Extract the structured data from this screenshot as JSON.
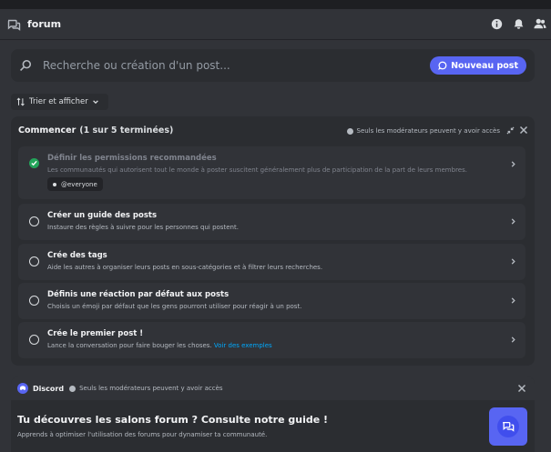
{
  "header": {
    "channel_name": "forum"
  },
  "search": {
    "placeholder": "Recherche ou création d'un post...",
    "new_post_label": "Nouveau post"
  },
  "sort": {
    "label": "Trier et afficher"
  },
  "onboarding": {
    "title": "Commencer",
    "progress": "(1 sur 5 terminées)",
    "mod_note": "Seuls les modérateurs peuvent y avoir accès",
    "tasks": [
      {
        "title": "Définir les permissions recommandées",
        "description": "Les communautés qui autorisent tout le monde à poster suscitent généralement plus de participation de la part de leurs membres.",
        "role": "@everyone",
        "completed": true
      },
      {
        "title": "Créer un guide des posts",
        "description": "Instaure des règles à suivre pour les personnes qui postent.",
        "completed": false
      },
      {
        "title": "Crée des tags",
        "description": "Aide les autres à organiser leurs posts en sous-catégories et à filtrer leurs recherches.",
        "completed": false
      },
      {
        "title": "Définis une réaction par défaut aux posts",
        "description": "Choisis un émoji par défaut que les gens pourront utiliser pour réagir à un post.",
        "completed": false
      },
      {
        "title": "Crée le premier post !",
        "description": "Lance la conversation pour faire bouger les choses.",
        "link": "Voir des exemples",
        "completed": false
      }
    ]
  },
  "guide": {
    "brand": "Discord",
    "mod_note": "Seuls les modérateurs peuvent y avoir accès",
    "title": "Tu découvres les salons forum ? Consulte notre guide !",
    "subtitle": "Apprends à optimiser l'utilisation des forums pour dynamiser ta communauté."
  },
  "colors": {
    "accent": "#5865f2",
    "success": "#23a55a",
    "link": "#00a8fc"
  }
}
